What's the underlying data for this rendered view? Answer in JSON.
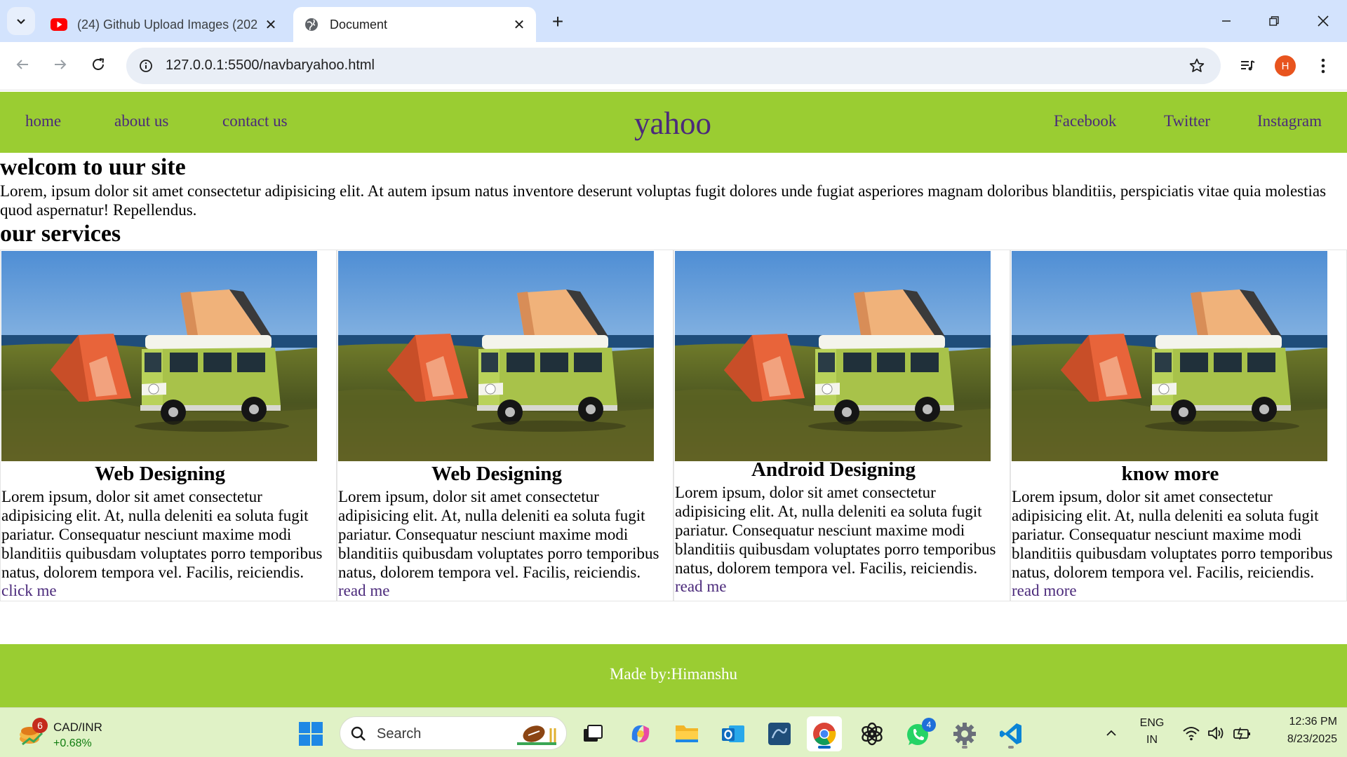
{
  "browser": {
    "tabs": [
      {
        "title": "(24) Github Upload Images (202",
        "favicon": "youtube-icon",
        "active": false
      },
      {
        "title": "Document",
        "favicon": "globe-icon",
        "active": true
      }
    ],
    "url": "127.0.0.1:5500/navbaryahoo.html",
    "profile_initial": "H"
  },
  "page": {
    "nav": {
      "left_links": [
        "home",
        "about us",
        "contact us"
      ],
      "brand": "yahoo",
      "right_links": [
        "Facebook",
        "Twitter",
        "Instagram"
      ],
      "background": "#9acd32",
      "link_color": "#4b2a7b"
    },
    "welcome_heading": "welcom to uur site",
    "intro_text": "Lorem, ipsum dolor sit amet consectetur adipisicing elit. At autem ipsum natus inventore deserunt voluptas fugit dolores unde fugiat asperiores magnam doloribus blanditiis, perspiciatis vitae quia molestias quod aspernatur! Repellendus.",
    "services_heading": "our services",
    "cards": [
      {
        "title": "Web Designing",
        "body": "Lorem ipsum, dolor sit amet consectetur adipisicing elit. At, nulla deleniti ea soluta fugit pariatur. Consequatur nesciunt maxime modi blanditiis quibusdam voluptates porro temporibus natus, dolorem tempora vel. Facilis, reiciendis.",
        "link": "click me"
      },
      {
        "title": "Web Designing",
        "body": "Lorem ipsum, dolor sit amet consectetur adipisicing elit. At, nulla deleniti ea soluta fugit pariatur. Consequatur nesciunt maxime modi blanditiis quibusdam voluptates porro temporibus natus, dolorem tempora vel. Facilis, reiciendis.",
        "link": "read me"
      },
      {
        "title": "Android Designing",
        "body": "Lorem ipsum, dolor sit amet consectetur adipisicing elit. At, nulla deleniti ea soluta fugit pariatur. Consequatur nesciunt maxime modi blanditiis quibusdam voluptates porro temporibus natus, dolorem tempora vel. Facilis, reiciendis.",
        "link": "read me"
      },
      {
        "title": "know more",
        "body": "Lorem ipsum, dolor sit amet consectetur adipisicing elit. At, nulla deleniti ea soluta fugit pariatur. Consequatur nesciunt maxime modi blanditiis quibusdam voluptates porro temporibus natus, dolorem tempora vel. Facilis, reiciendis.",
        "link": "read more"
      }
    ],
    "footer": "Made by:Himanshu"
  },
  "taskbar": {
    "ticker": {
      "badge": "6",
      "symbol": "CAD/INR",
      "change": "+0.68%"
    },
    "search_placeholder": "Search",
    "apps": [
      "windows-start-icon",
      "task-view-icon",
      "copilot-icon",
      "file-explorer-icon",
      "outlook-icon",
      "mysql-workbench-icon",
      "chrome-icon",
      "chatgpt-icon",
      "whatsapp-icon",
      "settings-icon",
      "vscode-icon"
    ],
    "whatsapp_badge": "4",
    "language": {
      "line1": "ENG",
      "line2": "IN"
    },
    "time": "12:36 PM",
    "date": "8/23/2025"
  }
}
